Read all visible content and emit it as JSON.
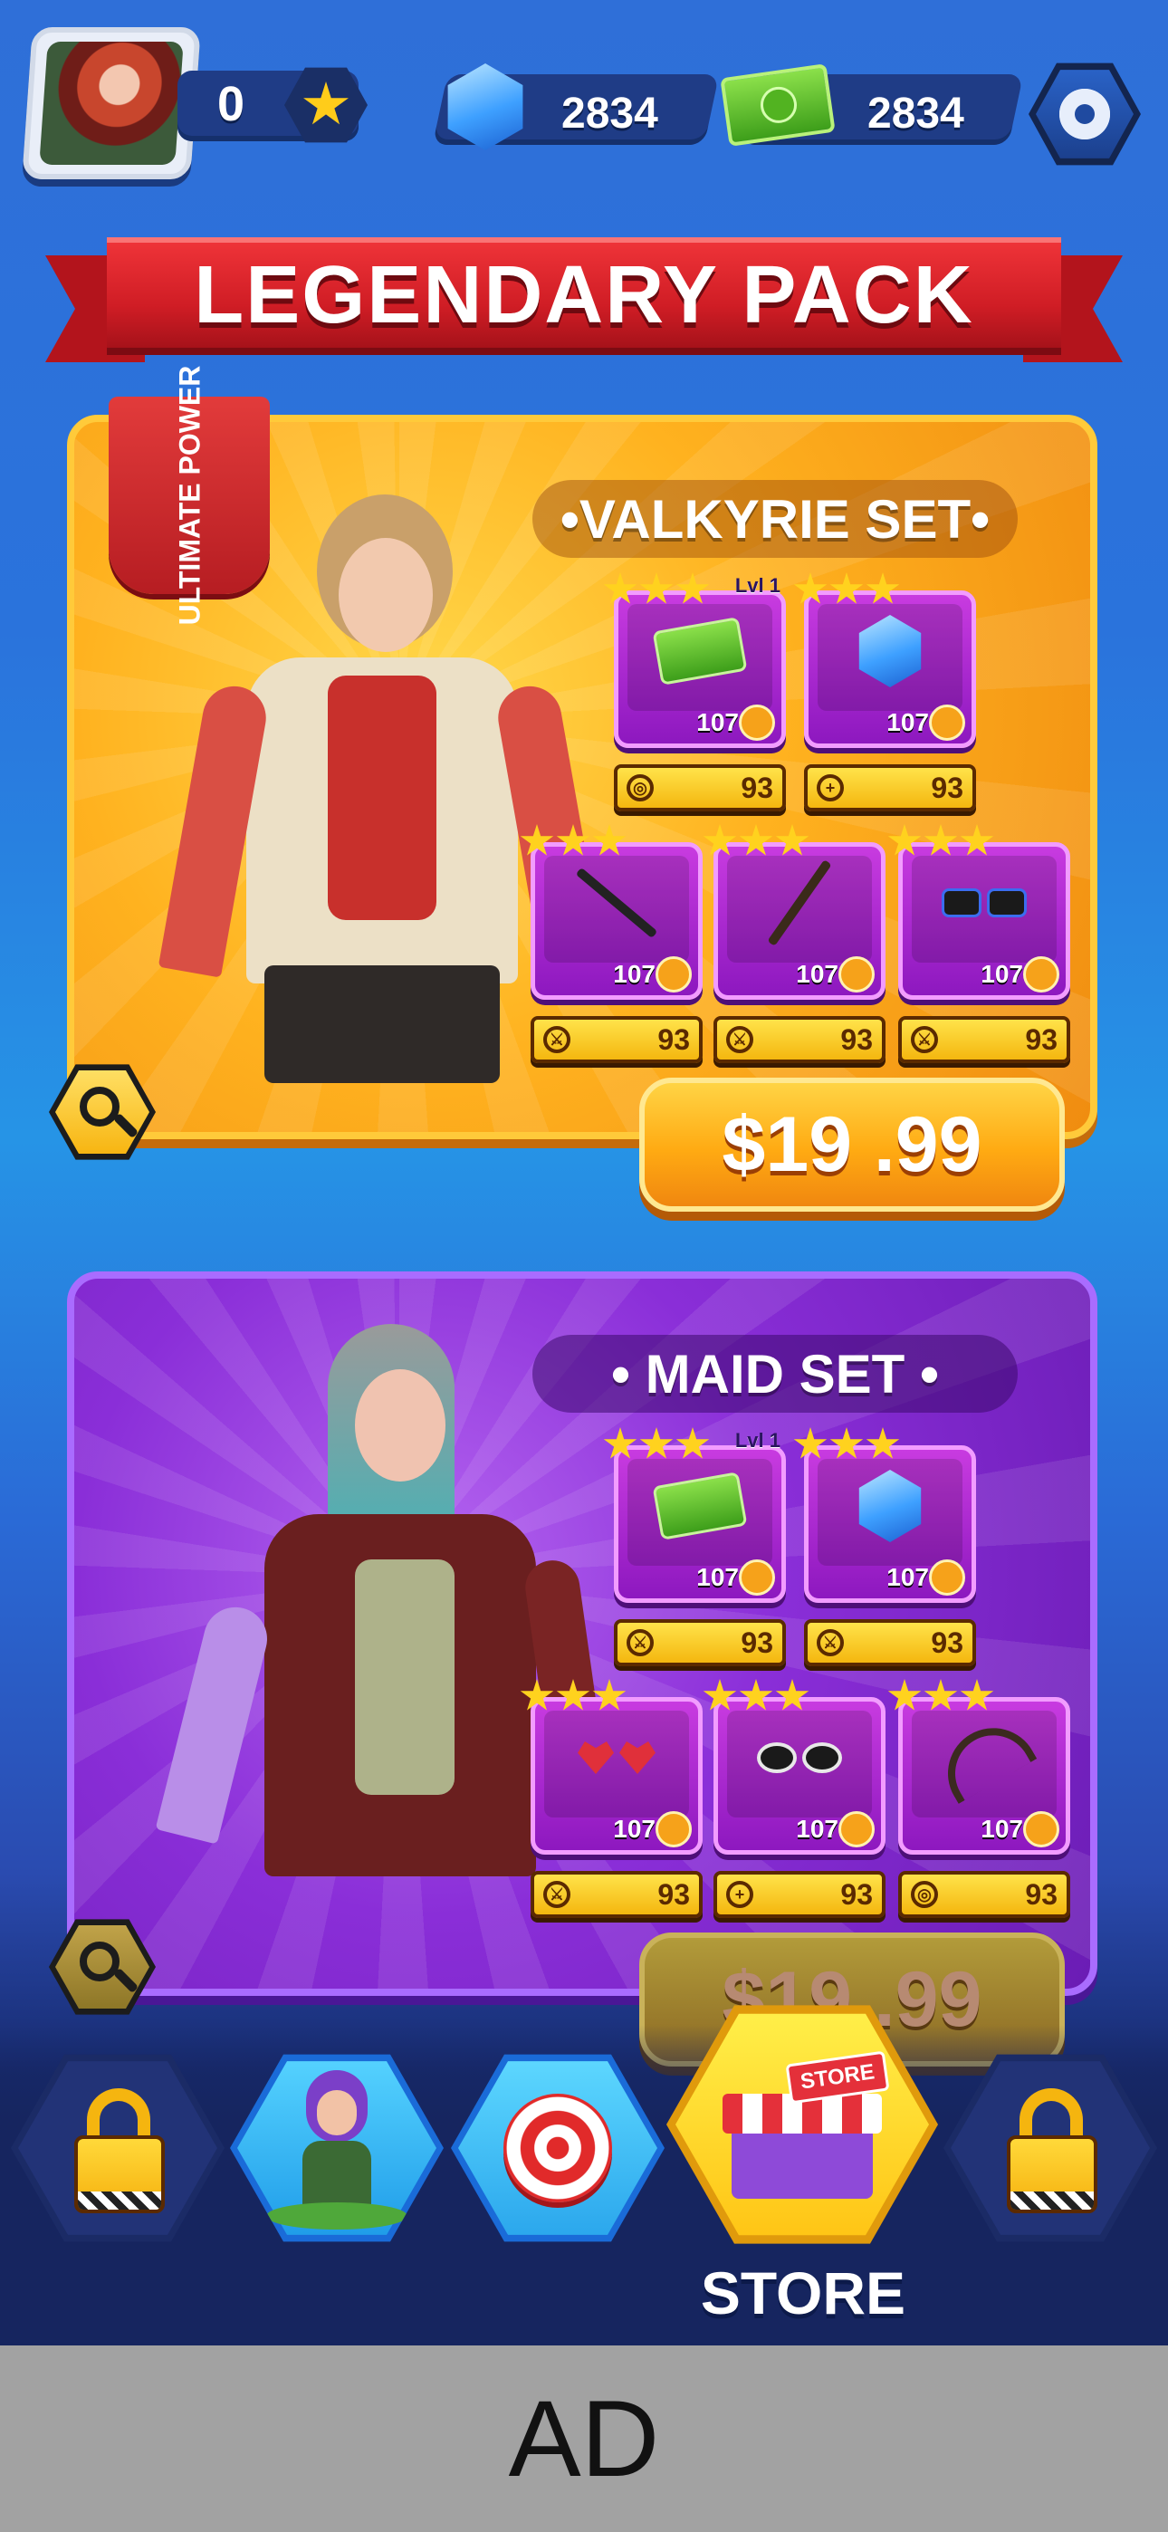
{
  "topbar": {
    "star_count": "0",
    "gems": "2834",
    "cash": "2834"
  },
  "banner": {
    "title": "LEGENDARY PACK"
  },
  "packs": [
    {
      "tag": "ULTIMATE POWER",
      "set_name": "•VALKYRIE SET•",
      "price": "$19 .99",
      "items": [
        {
          "level": "Lvl 1",
          "art": "cash",
          "count": "107",
          "stat_icon": "target",
          "stat": "93"
        },
        {
          "level": "",
          "art": "gem",
          "count": "107",
          "stat_icon": "plus",
          "stat": "93"
        },
        {
          "level": "",
          "art": "spear",
          "count": "107",
          "stat_icon": "swords",
          "stat": "93"
        },
        {
          "level": "",
          "art": "spear",
          "count": "107",
          "stat_icon": "swords",
          "stat": "93"
        },
        {
          "level": "",
          "art": "sunglasses",
          "count": "107",
          "stat_icon": "swords",
          "stat": "93"
        }
      ]
    },
    {
      "tag": "",
      "set_name": "• MAID SET •",
      "price": "$19 .99",
      "items": [
        {
          "level": "Lvl 1",
          "art": "cash",
          "count": "107",
          "stat_icon": "swords",
          "stat": "93"
        },
        {
          "level": "",
          "art": "gem",
          "count": "107",
          "stat_icon": "swords",
          "stat": "93"
        },
        {
          "level": "",
          "art": "heart-glasses",
          "count": "107",
          "stat_icon": "swords",
          "stat": "93"
        },
        {
          "level": "",
          "art": "goggles",
          "count": "107",
          "stat_icon": "plus",
          "stat": "93"
        },
        {
          "level": "",
          "art": "crossbow",
          "count": "107",
          "stat_icon": "target",
          "stat": "93"
        }
      ]
    }
  ],
  "nav": {
    "store_sign": "STORE",
    "store_label": "STORE"
  },
  "ad": {
    "label": "AD"
  },
  "colors": {
    "gold": "#ffb21f",
    "purple": "#8a2ed8",
    "ribbon_red": "#d01d25",
    "nav_cyan": "#3cc8f0"
  }
}
